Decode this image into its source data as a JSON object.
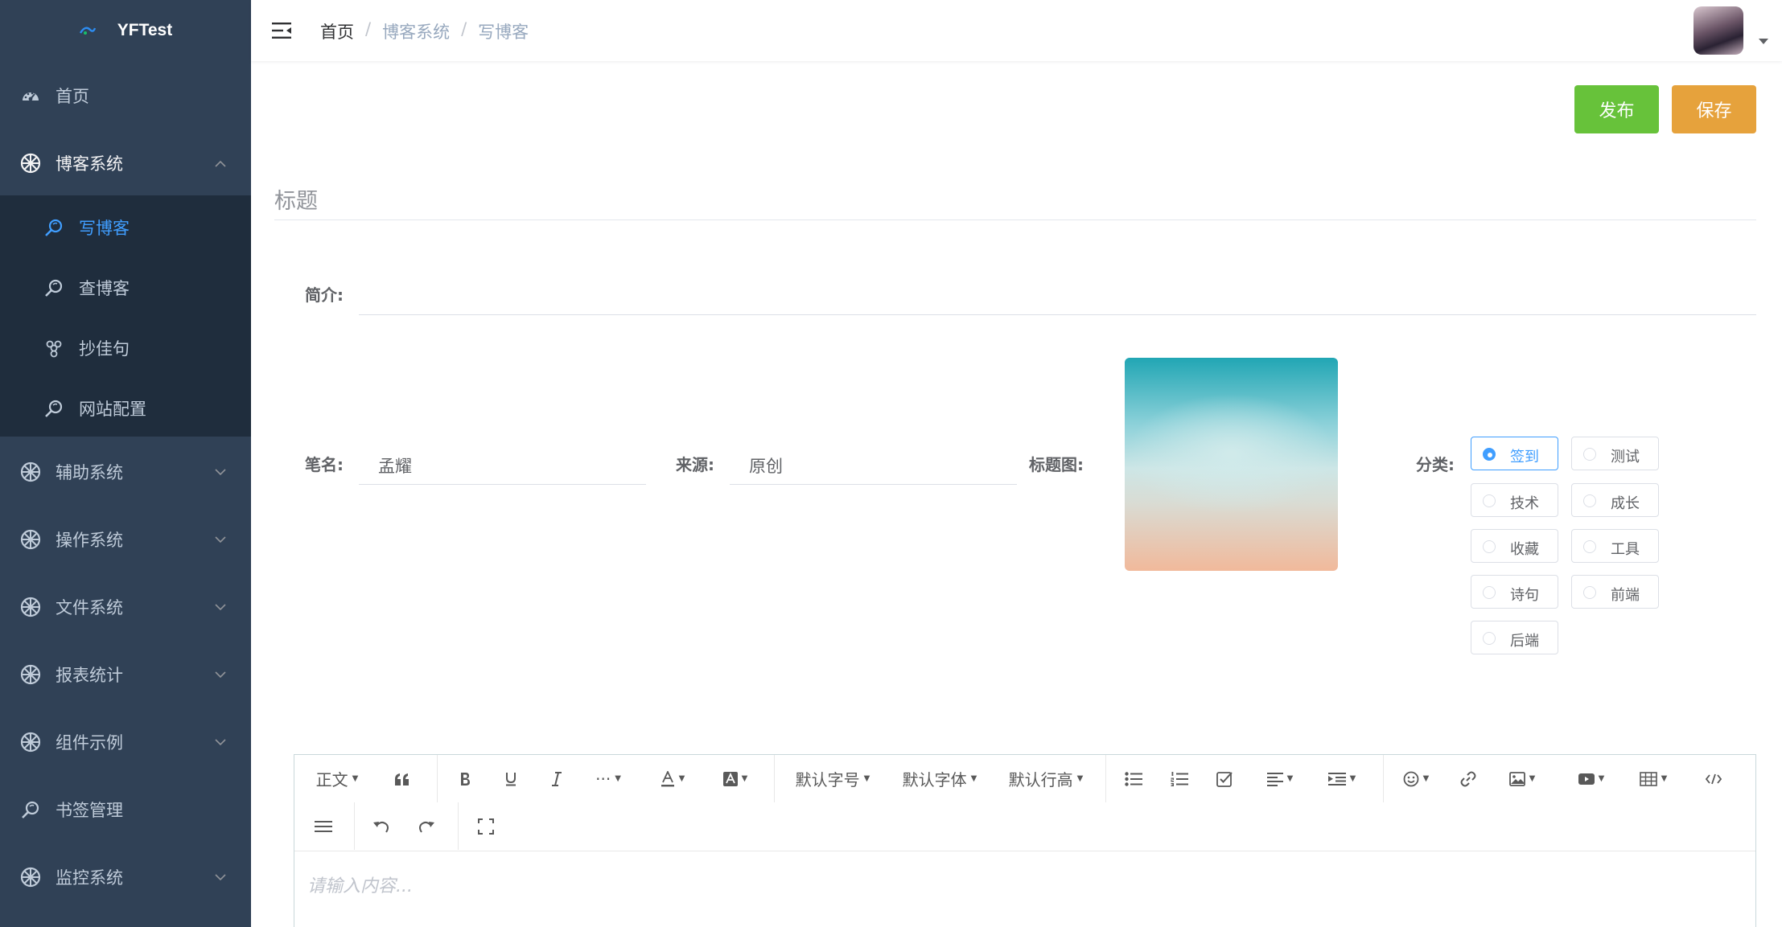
{
  "app": {
    "logo_text": "YFTest"
  },
  "sidebar": {
    "items": [
      {
        "label": "首页",
        "icon": "dashboard-icon",
        "has_arrow": false
      },
      {
        "label": "博客系统",
        "icon": "wheel-icon",
        "has_arrow": true,
        "expanded": true
      },
      {
        "label": "辅助系统",
        "icon": "wheel-icon",
        "has_arrow": true
      },
      {
        "label": "操作系统",
        "icon": "wheel-icon",
        "has_arrow": true
      },
      {
        "label": "文件系统",
        "icon": "wheel-icon",
        "has_arrow": true
      },
      {
        "label": "报表统计",
        "icon": "wheel-icon",
        "has_arrow": true
      },
      {
        "label": "组件示例",
        "icon": "wheel-icon",
        "has_arrow": true
      },
      {
        "label": "书签管理",
        "icon": "search-icon",
        "has_arrow": false
      },
      {
        "label": "监控系统",
        "icon": "wheel-icon",
        "has_arrow": true
      }
    ],
    "blog_submenu": [
      {
        "label": "写博客",
        "icon": "search-icon",
        "active": true
      },
      {
        "label": "查博客",
        "icon": "search-icon"
      },
      {
        "label": "抄佳句",
        "icon": "grape-icon"
      },
      {
        "label": "网站配置",
        "icon": "search-icon"
      }
    ]
  },
  "header": {
    "breadcrumb": [
      "首页",
      "博客系统",
      "写博客"
    ],
    "separator": "/"
  },
  "actions": {
    "publish": "发布",
    "save": "保存"
  },
  "form": {
    "title_placeholder": "标题",
    "summary_label": "简介:",
    "summary_value": "",
    "author_label": "笔名:",
    "author_value": "孟耀",
    "source_label": "来源:",
    "source_value": "原创",
    "cover_label": "标题图:",
    "category_label": "分类:",
    "categories": [
      {
        "label": "签到",
        "checked": true
      },
      {
        "label": "测试",
        "checked": false
      },
      {
        "label": "技术",
        "checked": false
      },
      {
        "label": "成长",
        "checked": false
      },
      {
        "label": "收藏",
        "checked": false
      },
      {
        "label": "工具",
        "checked": false
      },
      {
        "label": "诗句",
        "checked": false
      },
      {
        "label": "前端",
        "checked": false
      },
      {
        "label": "后端",
        "checked": false
      }
    ]
  },
  "editor": {
    "toolbar": {
      "paragraph": "正文",
      "font_size": "默认字号",
      "font_family": "默认字体",
      "line_height": "默认行高",
      "more": "···"
    },
    "placeholder": "请输入内容..."
  },
  "colors": {
    "sidebar_bg": "#304156",
    "submenu_bg": "#1f2d3d",
    "active_text": "#409eff",
    "publish_btn": "#67c23a",
    "save_btn": "#e6a23c"
  }
}
